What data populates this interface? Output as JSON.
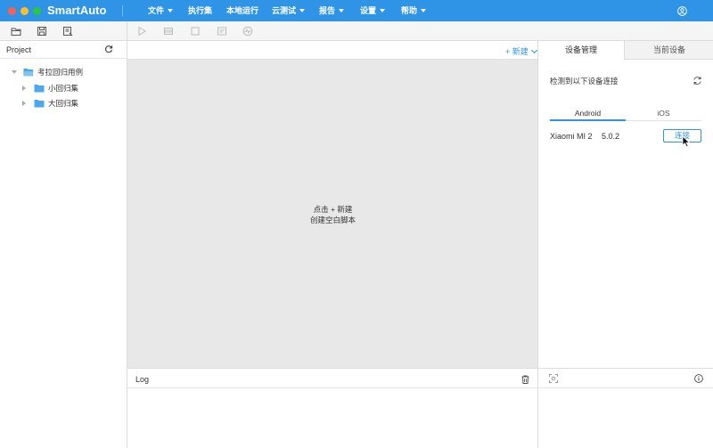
{
  "app": {
    "title": "SmartAuto"
  },
  "menu": [
    {
      "label": "文件",
      "has_caret": true
    },
    {
      "label": "执行集",
      "has_caret": false
    },
    {
      "label": "本地运行",
      "has_caret": false
    },
    {
      "label": "云测试",
      "has_caret": true
    },
    {
      "label": "报告",
      "has_caret": true
    },
    {
      "label": "设置",
      "has_caret": true
    },
    {
      "label": "帮助",
      "has_caret": true
    }
  ],
  "project": {
    "title": "Project",
    "tree": [
      {
        "label": "考拉回归用例",
        "level": 0,
        "expanded": true
      },
      {
        "label": "小回归集",
        "level": 1,
        "expanded": false
      },
      {
        "label": "大回归集",
        "level": 1,
        "expanded": false
      }
    ]
  },
  "editor": {
    "new_label": "+ 新建",
    "hint_line1": "点击 + 新建",
    "hint_line2": "创建空白脚本"
  },
  "log": {
    "title": "Log"
  },
  "right_panel": {
    "tabs": [
      {
        "label": "设备管理",
        "active": true
      },
      {
        "label": "当前设备",
        "active": false
      }
    ],
    "detect_text": "检测到以下设备连接",
    "platform_tabs": [
      {
        "label": "Android",
        "active": true
      },
      {
        "label": "iOS",
        "active": false
      }
    ],
    "device": {
      "name": "Xiaomi MI 2",
      "version": "5.0.2",
      "connect_label": "连接"
    }
  },
  "colors": {
    "accent": "#2f93e6",
    "editor_bg": "#e8e8e8",
    "folder": "#4aa8ec"
  }
}
